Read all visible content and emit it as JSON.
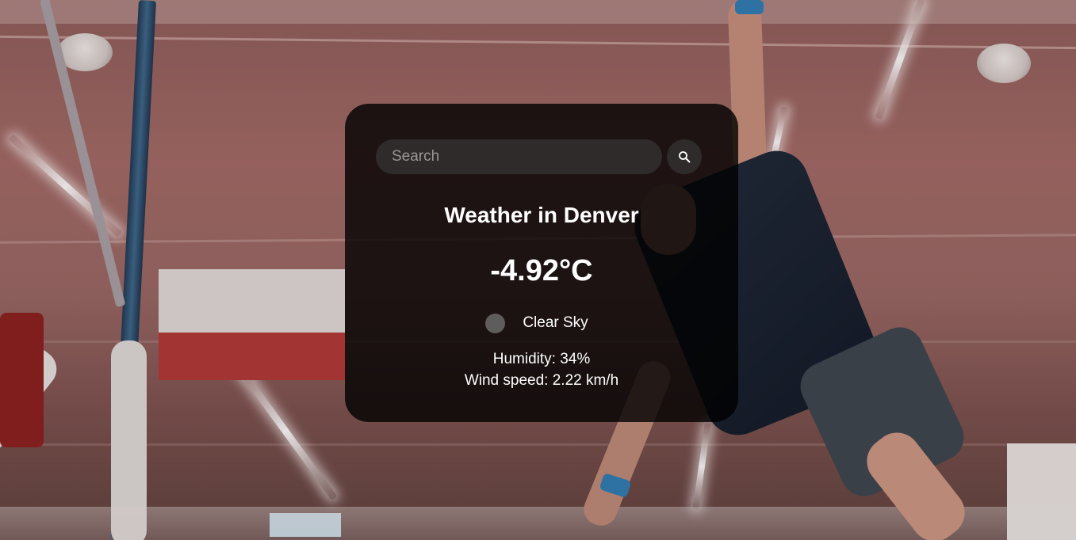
{
  "search": {
    "placeholder": "Search",
    "button_icon": "search-icon"
  },
  "weather": {
    "title": "Weather in Denver",
    "temperature": "-4.92°C",
    "description": "Clear Sky",
    "icon": "weather-condition-icon",
    "humidity": "Humidity: 34%",
    "wind": "Wind speed: 2.22 km/h"
  },
  "colors": {
    "card_background": "#000000cc",
    "input_background": "#2f2b2b",
    "text": "#ffffff"
  },
  "background": {
    "description_icon": "gym-background-image"
  }
}
